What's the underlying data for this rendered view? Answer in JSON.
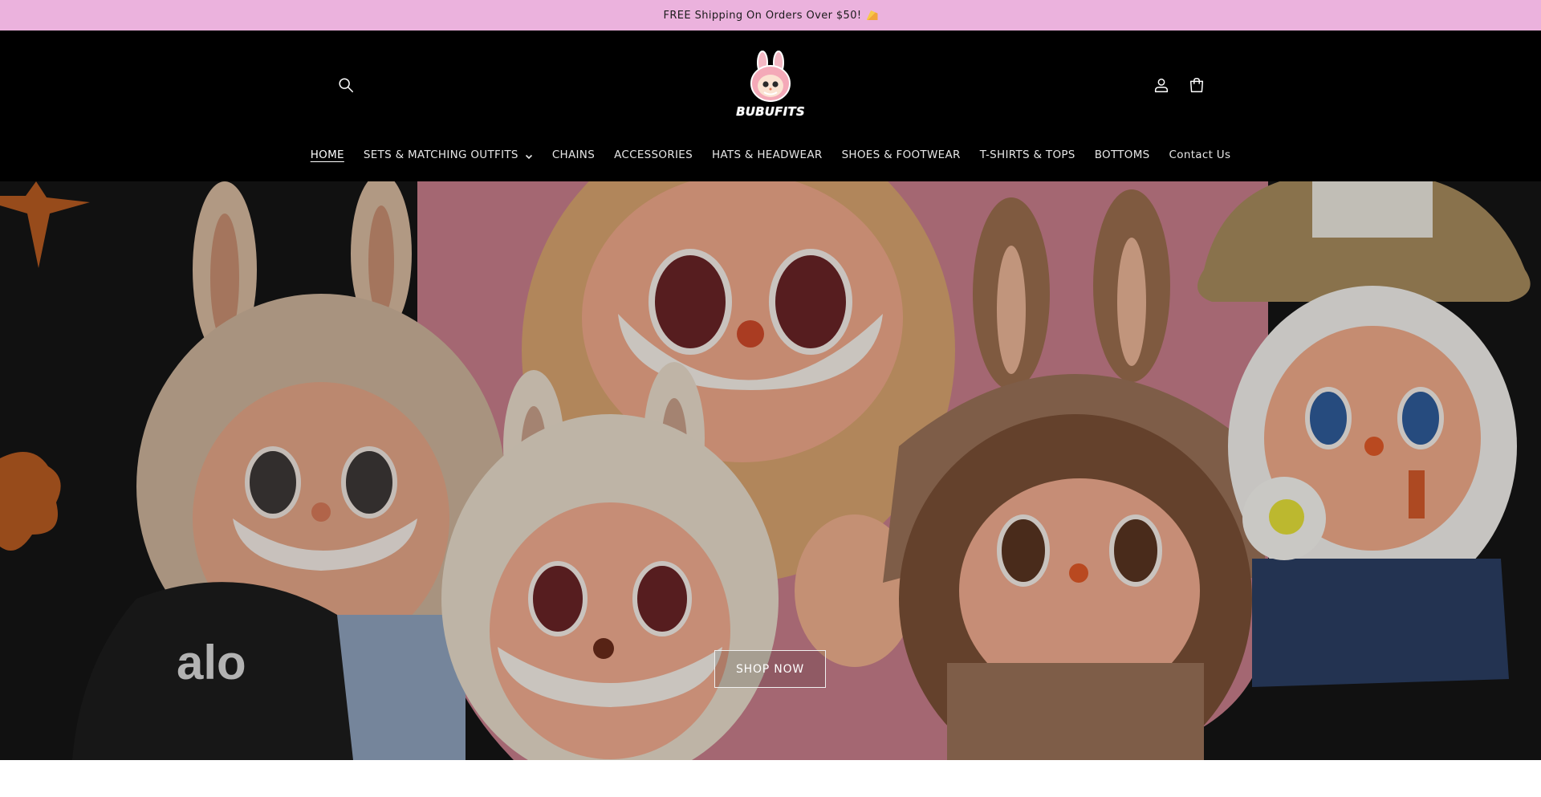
{
  "announcement": {
    "text": "FREE Shipping On Orders Over $50!",
    "emoji_icon": "cheese-icon"
  },
  "header": {
    "logo_text": "BUBUFITS",
    "icons": [
      "search-icon",
      "account-icon",
      "cart-icon"
    ],
    "background": "#000000"
  },
  "nav": {
    "items": [
      {
        "label": "HOME",
        "active": true
      },
      {
        "label": "SETS & MATCHING OUTFITS",
        "has_dropdown": true
      },
      {
        "label": "CHAINS"
      },
      {
        "label": "ACCESSORIES"
      },
      {
        "label": "HATS & HEADWEAR"
      },
      {
        "label": "SHOES & FOOTWEAR"
      },
      {
        "label": "T-SHIRTS & TOPS"
      },
      {
        "label": "BOTTOMS"
      },
      {
        "label": "Contact Us"
      }
    ]
  },
  "hero": {
    "cta_label": "SHOP NOW",
    "hat_text": "alo"
  },
  "colors": {
    "announcement_bg": "#ebb2dd",
    "hero_pink": "#d98b9b",
    "plush_tan": "#d9b08a",
    "plush_cream": "#efe3d3"
  }
}
